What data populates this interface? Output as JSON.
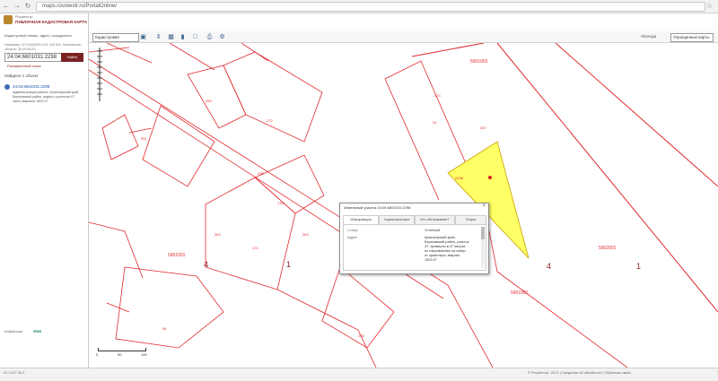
{
  "browser": {
    "url": "maps.rosreestr.ru/PortalOnline/"
  },
  "header": {
    "org": "Росреестр",
    "brand": "ПУБЛИЧНАЯ КАДАСТРОВАЯ КАРТА",
    "hint": "Кадастровый номер, адрес, координаты",
    "example": "Например: 47:14:603001:123, 200 501, Московская область: 39.29-59.33"
  },
  "search": {
    "value": "24:04:6601031:2298",
    "find_label": "Найти",
    "extended_label": "Расширенный поиск"
  },
  "results": {
    "title": "Найдено 1 объект",
    "number": "24:04:6601031:2298",
    "description": "Администрация района. Красноярский край, Березовский район, рядом с участком 47, часть квартала 1502:47"
  },
  "favorites_label": "Избранное",
  "toolbar": {
    "layer": "Кадастровая",
    "legend": "Легенда",
    "basemap": "Упрощенные карты"
  },
  "popup": {
    "title": "Земельный участок 24:04:6601031:2298",
    "close": "×",
    "tabs": [
      "Информация",
      "Характеристики",
      "Кто обслуживает?",
      "Услуги"
    ],
    "fields": [
      {
        "label": "Статус",
        "value": "Учтенный"
      },
      {
        "label": "Адрес",
        "value": "Красноярский край, Березовский район, участок 47, примерно в 47 метрах по направлению на север от ориентира, квартал 1502:47"
      }
    ]
  },
  "map": {
    "labels": [
      "5901001",
      "5901001",
      "5901001",
      "5902001",
      "4",
      "1",
      "4",
      "1",
      "174",
      "176",
      "263",
      "272",
      "235",
      "251",
      "260",
      "263",
      "274",
      "347",
      "31",
      "2298",
      "94",
      "77",
      "290"
    ],
    "scale": [
      "0",
      "50",
      "100"
    ]
  },
  "status": {
    "latlon": "61.1447 58.4",
    "copyright": "© Росреестр, 2013 | Сведения об обработке | Обратная связь"
  },
  "colors": {
    "parcel_line": "#e0292e",
    "selected_fill": "#ffff66",
    "brand": "#8b1a1a"
  }
}
